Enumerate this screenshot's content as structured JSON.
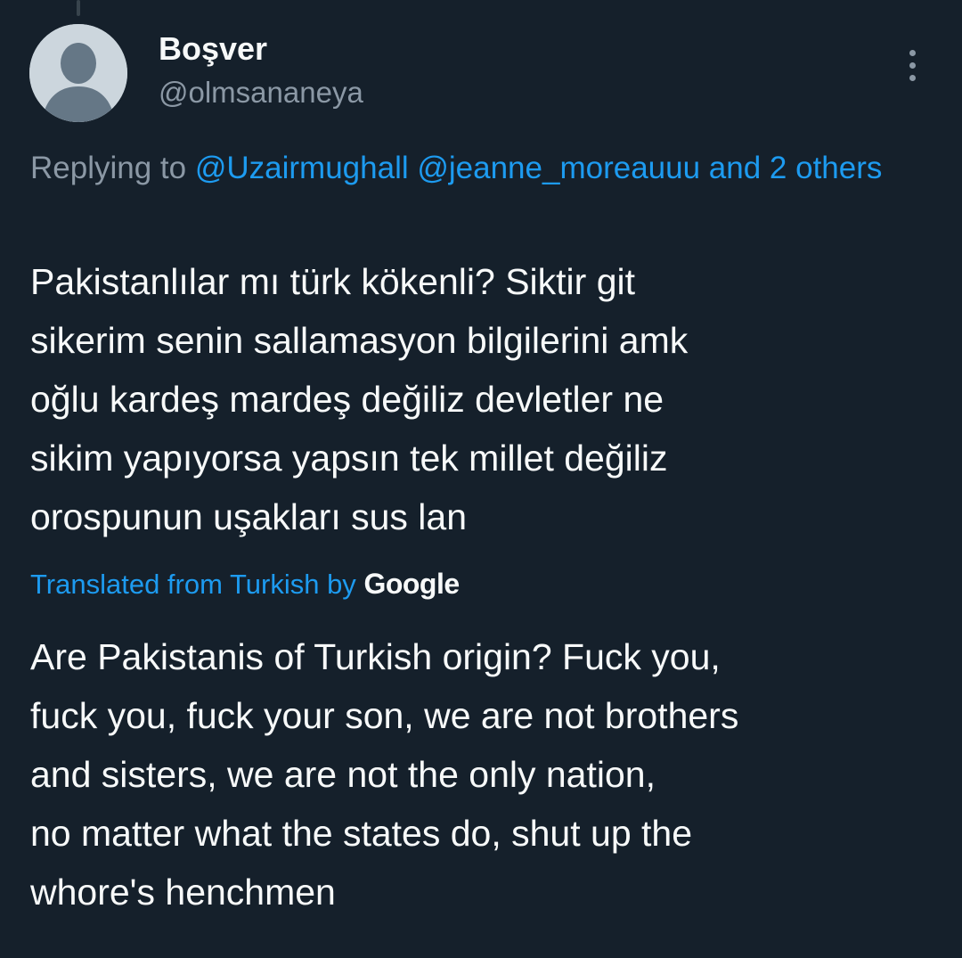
{
  "tweet": {
    "author": {
      "display_name": "Boşver",
      "handle": "@olmsananeya",
      "avatar_icon": "default-profile-icon"
    },
    "more_icon": "more-vertical-icon",
    "reply": {
      "prefix": "Replying to",
      "mentions": [
        "@Uzairmughall",
        "@jeanne_moreauuu"
      ],
      "suffix": "and 2 others"
    },
    "text": "Pakistanlılar mı türk kökenli? Siktir git\nsikerim senin sallamasyon bilgilerini amk\noğlu kardeş mardeş değiliz devletler ne\nsikim yapıyorsa yapsın tek millet değiliz\norospunun uşakları sus lan",
    "translation": {
      "label": "Translated from Turkish by",
      "provider": "Google",
      "text": "Are Pakistanis of Turkish origin? Fuck you,\nfuck you, fuck your son, we are not brothers\nand sisters, we are not the only nation,\nno matter what the states do, shut up the\nwhore's henchmen"
    }
  },
  "colors": {
    "background": "#15202b",
    "primary_text": "#f7f9f9",
    "secondary_text": "#8b98a5",
    "link": "#1d9bf0"
  }
}
